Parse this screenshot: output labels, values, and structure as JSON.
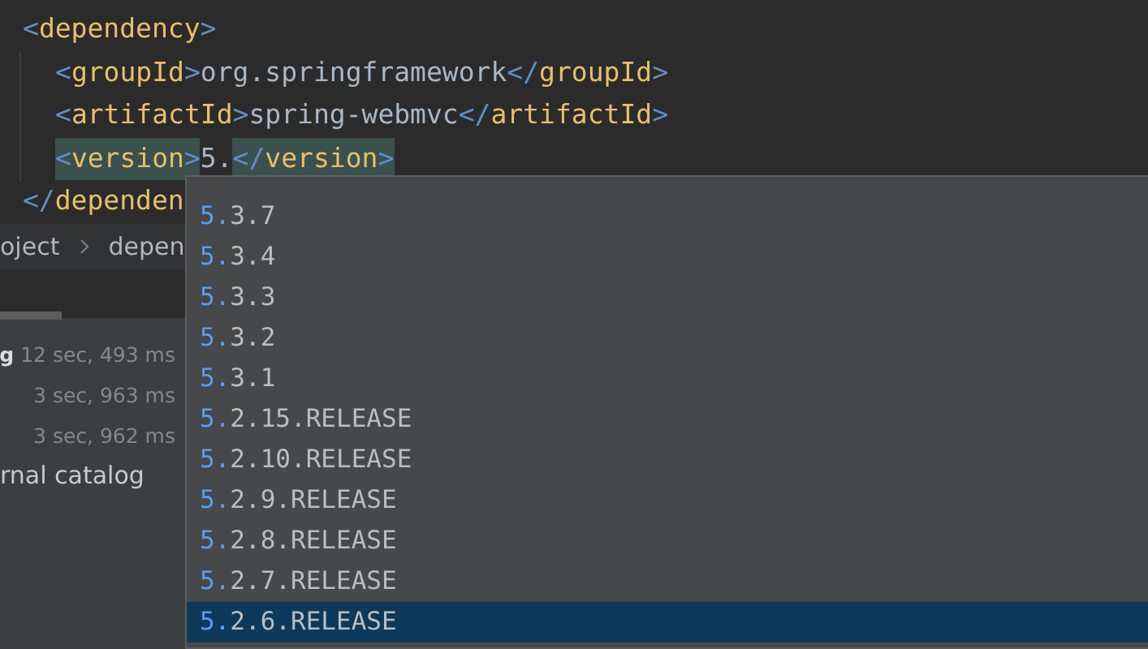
{
  "editor": {
    "lines": [
      {
        "highlighted": false,
        "tokens": [
          {
            "kind": "punct",
            "text": "<"
          },
          {
            "kind": "tag",
            "text": "dependency"
          },
          {
            "kind": "punct",
            "text": ">"
          }
        ],
        "children": [
          {
            "highlighted": false,
            "tokens": [
              {
                "kind": "punct",
                "text": "<"
              },
              {
                "kind": "tag",
                "text": "groupId"
              },
              {
                "kind": "punct",
                "text": ">"
              },
              {
                "kind": "value",
                "text": "org.springframework"
              },
              {
                "kind": "punct",
                "text": "</"
              },
              {
                "kind": "tag",
                "text": "groupId"
              },
              {
                "kind": "punct",
                "text": ">"
              }
            ]
          },
          {
            "highlighted": false,
            "tokens": [
              {
                "kind": "punct",
                "text": "<"
              },
              {
                "kind": "tag",
                "text": "artifactId"
              },
              {
                "kind": "punct",
                "text": ">"
              },
              {
                "kind": "value",
                "text": "spring-webmvc"
              },
              {
                "kind": "punct",
                "text": "</"
              },
              {
                "kind": "tag",
                "text": "artifactId"
              },
              {
                "kind": "punct",
                "text": ">"
              }
            ]
          },
          {
            "highlighted": true,
            "tokens": [
              {
                "kind": "punct",
                "text": "<"
              },
              {
                "kind": "tag",
                "text": "version"
              },
              {
                "kind": "punct",
                "text": ">"
              },
              {
                "kind": "value",
                "text": "5."
              },
              {
                "kind": "punct",
                "text": "</"
              },
              {
                "kind": "tag",
                "text": "version"
              },
              {
                "kind": "punct",
                "text": ">"
              }
            ]
          }
        ]
      },
      {
        "highlighted": false,
        "tokens": [
          {
            "kind": "punct",
            "text": "</"
          },
          {
            "kind": "tag",
            "text": "dependen"
          }
        ]
      }
    ]
  },
  "breadcrumbs": [
    "oject",
    "depen"
  ],
  "run_panel": {
    "rows": [
      {
        "label": "g",
        "duration": "12 sec, 493 ms"
      },
      {
        "duration": "3 sec, 963 ms"
      },
      {
        "duration": "3 sec, 962 ms"
      }
    ],
    "footer": "rnal catalog"
  },
  "completion": {
    "items": [
      {
        "match": "5.",
        "rest": "3.7",
        "selected": false
      },
      {
        "match": "5.",
        "rest": "3.4",
        "selected": false
      },
      {
        "match": "5.",
        "rest": "3.3",
        "selected": false
      },
      {
        "match": "5.",
        "rest": "3.2",
        "selected": false
      },
      {
        "match": "5.",
        "rest": "3.1",
        "selected": false
      },
      {
        "match": "5.",
        "rest": "2.15.RELEASE",
        "selected": false
      },
      {
        "match": "5.",
        "rest": "2.10.RELEASE",
        "selected": false
      },
      {
        "match": "5.",
        "rest": "2.9.RELEASE",
        "selected": false
      },
      {
        "match": "5.",
        "rest": "2.8.RELEASE",
        "selected": false
      },
      {
        "match": "5.",
        "rest": "2.7.RELEASE",
        "selected": false
      },
      {
        "match": "5.",
        "rest": "2.6.RELEASE",
        "selected": true
      }
    ]
  }
}
